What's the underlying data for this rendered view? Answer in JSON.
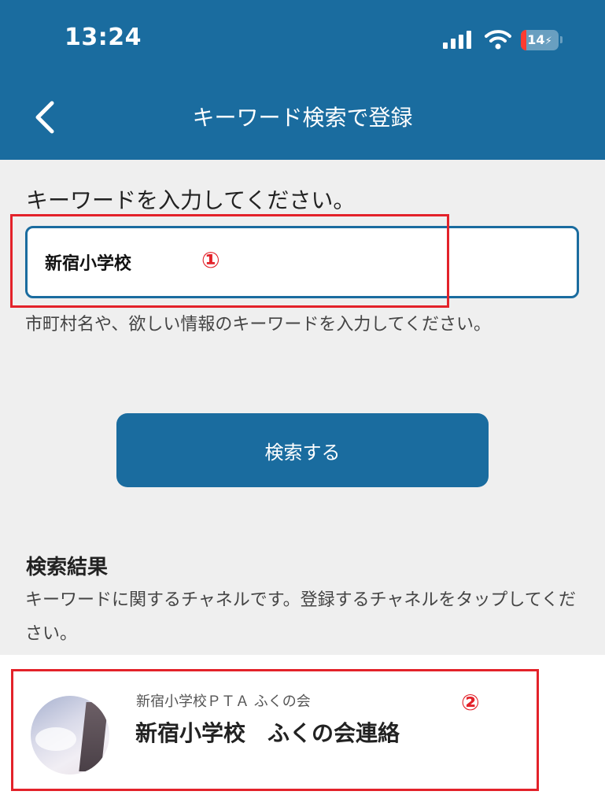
{
  "status_bar": {
    "time": "13:24",
    "battery_text": "14",
    "battery_level_percent": 14,
    "icons": [
      "signal-icon",
      "wifi-icon",
      "battery-icon",
      "charging-bolt-icon"
    ]
  },
  "nav": {
    "back_icon": "chevron-left-icon",
    "title": "キーワード検索で登録"
  },
  "search": {
    "prompt": "キーワードを入力してください。",
    "value": "新宿小学校",
    "hint": "市町村名や、欲しい情報のキーワードを入力してください。",
    "button_label": "検索する"
  },
  "results": {
    "title": "検索結果",
    "description": "キーワードに関するチャネルです。登録するチャネルをタップしてください。",
    "items": [
      {
        "organization": "新宿小学校ＰＴＡ ふくの会",
        "name": "新宿小学校　ふくの会連絡"
      }
    ]
  },
  "annotations": {
    "marker_1": "①",
    "marker_2": "②",
    "color": "#e3222a"
  },
  "colors": {
    "header": "#1a6c9f",
    "background": "#efefef",
    "button": "#1a6c9f"
  }
}
